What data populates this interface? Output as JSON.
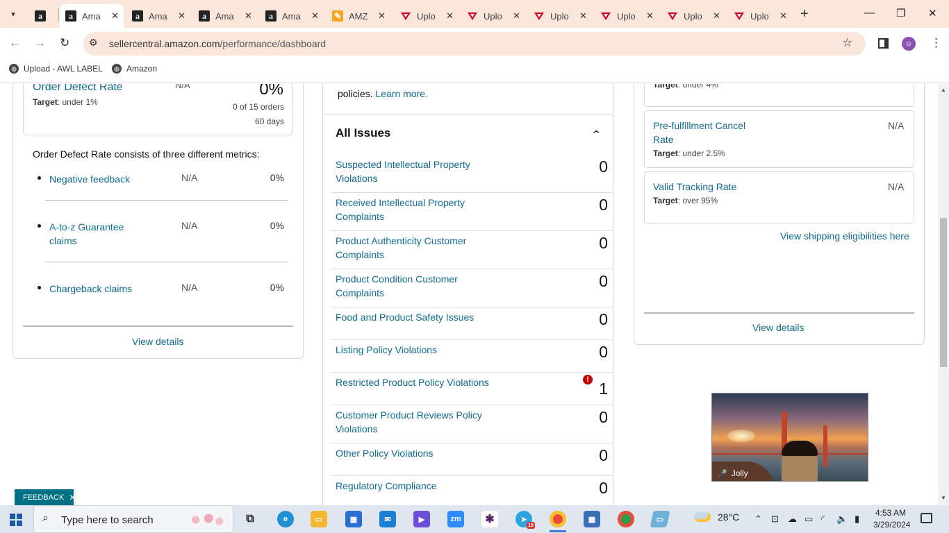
{
  "browser": {
    "tabs": [
      {
        "title": "",
        "icon": "amazon-icon"
      },
      {
        "title": "Ama",
        "icon": "amazon-icon",
        "active": true
      },
      {
        "title": "Ama",
        "icon": "amazon-icon"
      },
      {
        "title": "Ama",
        "icon": "amazon-icon"
      },
      {
        "title": "Ama",
        "icon": "amazon-icon"
      },
      {
        "title": "AMZ",
        "icon": "amzkey-icon"
      },
      {
        "title": "Uplo",
        "icon": "upload-icon"
      },
      {
        "title": "Uplo",
        "icon": "upload-icon"
      },
      {
        "title": "Uplo",
        "icon": "upload-icon"
      },
      {
        "title": "Uplo",
        "icon": "upload-icon"
      },
      {
        "title": "Uplo",
        "icon": "upload-icon"
      },
      {
        "title": "Uplo",
        "icon": "upload-icon"
      }
    ],
    "url_host": "sellercentral.amazon.com",
    "url_path": "/performance/dashboard",
    "bookmarks": [
      "Upload - AWL LABEL",
      "Amazon"
    ]
  },
  "odr": {
    "title": "Order Defect Rate",
    "na": "N/A",
    "percent": "0%",
    "target_label": "Target",
    "target_value": ": under 1%",
    "orders": "0 of 15 orders",
    "days": "60 days",
    "description": "Order Defect Rate consists of three different metrics:",
    "metrics": [
      {
        "label": "Negative feedback",
        "na": "N/A",
        "percent": "0%"
      },
      {
        "label": "A-to-z Guarantee claims",
        "na": "N/A",
        "percent": "0%"
      },
      {
        "label": "Chargeback claims",
        "na": "N/A",
        "percent": "0%"
      }
    ],
    "view_details": "View details"
  },
  "policy": {
    "top_text": "policies.",
    "learn_more": "Learn more.",
    "heading": "All Issues",
    "issues": [
      {
        "label": "Suspected Intellectual Property Violations",
        "value": "0"
      },
      {
        "label": "Received Intellectual Property Complaints",
        "value": "0"
      },
      {
        "label": "Product Authenticity Customer Complaints",
        "value": "0"
      },
      {
        "label": "Product Condition Customer Complaints",
        "value": "0"
      },
      {
        "label": "Food and Product Safety Issues",
        "value": "0"
      },
      {
        "label": "Listing Policy Violations",
        "value": "0"
      },
      {
        "label": "Restricted Product Policy Violations",
        "value": "1",
        "alert": "!"
      },
      {
        "label": "Customer Product Reviews Policy Violations",
        "value": "0"
      },
      {
        "label": "Other Policy Violations",
        "value": "0"
      },
      {
        "label": "Regulatory Compliance",
        "value": "0"
      }
    ]
  },
  "shipping": {
    "top_target_label": "Target",
    "top_target_value": ": under 4%",
    "metrics": [
      {
        "title": "Pre-fulfillment Cancel Rate",
        "na": "N/A",
        "target_label": "Target",
        "target_value": ": under 2.5%"
      },
      {
        "title": "Valid Tracking Rate",
        "na": "N/A",
        "target_label": "Target",
        "target_value": ": over 95%"
      }
    ],
    "eligibility_link": "View shipping eligibilities here",
    "view_details": "View details"
  },
  "video": {
    "name": "Jolly"
  },
  "feedback": {
    "label": "FEEDBACK",
    "close": "✕"
  },
  "taskbar": {
    "search_placeholder": "Type here to search",
    "temperature": "28°C",
    "time": "4:53 AM",
    "date": "3/29/2024",
    "telegram_badge": "19"
  },
  "colors": {
    "link": "#0f6b8f",
    "alert": "#c40000",
    "feedback_bg": "#007185",
    "tabstrip": "#fbe6dc"
  }
}
